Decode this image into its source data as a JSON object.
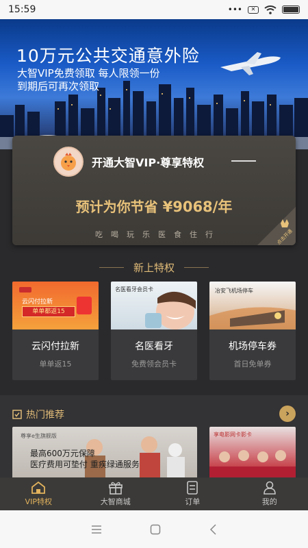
{
  "status_bar": {
    "time": "15:59",
    "dots": "•••"
  },
  "banner": {
    "title": "10万元公共交通意外险",
    "line1": "大智VIP免费领取 每人限领一份",
    "line2": "到期后可再次领取"
  },
  "vip_card": {
    "title": "开通大智VIP·尊享特权",
    "save_prefix": "预计为你节省 ",
    "save_amount": "¥9068/年",
    "categories": [
      "吃",
      "喝",
      "玩",
      "乐",
      "医",
      "食",
      "住",
      "行"
    ],
    "badge": "点击开通"
  },
  "new_section": {
    "title": "新上特权"
  },
  "features": [
    {
      "name": "云闪付拉新",
      "desc": "单单返15",
      "img_text1": "云闪付拉新",
      "img_text2": "单单都返15"
    },
    {
      "name": "名医看牙",
      "desc": "免费领会员卡",
      "img_text1": "名医看牙会员卡"
    },
    {
      "name": "机场停车券",
      "desc": "首日免单券",
      "img_text1": "冶安飞机场停车"
    }
  ],
  "hot": {
    "title": "热门推荐",
    "card1_small": "尊享e生旗舰版",
    "card1_line1": "最高600万元保障",
    "card1_line2": "医疗费用可垫付 重疾绿通服务",
    "card2_small": "享电影网卡影卡"
  },
  "tabs": [
    {
      "label": "VIP特权",
      "active": true
    },
    {
      "label": "大智商城",
      "active": false
    },
    {
      "label": "订单",
      "active": false
    },
    {
      "label": "我的",
      "active": false
    }
  ],
  "colors": {
    "gold": "#e0bb78",
    "accent": "#e3b35d",
    "bg": "#2a2a2c"
  }
}
